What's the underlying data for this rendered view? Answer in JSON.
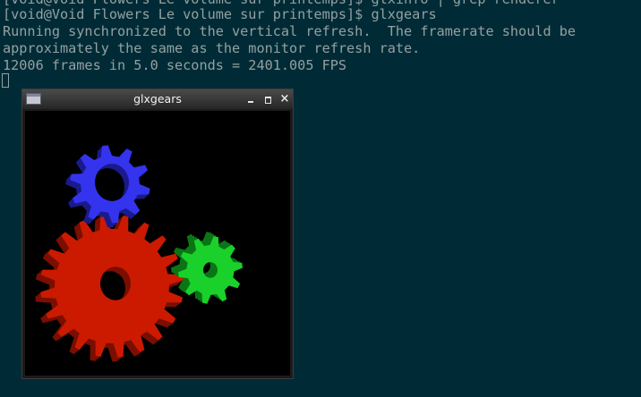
{
  "terminal": {
    "cutoff_line": "[void@Void Flowers Le volume sur printemps]$ glxinfo | grep renderer",
    "prompt": "[void@Void Flowers Le volume sur printemps]$ glxgears",
    "output": [
      "Running synchronized to the vertical refresh.  The framerate should be",
      "approximately the same as the monitor refresh rate.",
      "12006 frames in 5.0 seconds = 2401.005 FPS"
    ]
  },
  "window": {
    "title": "glxgears",
    "icon": "app-window-icon",
    "buttons": {
      "minimize": "minimize-icon",
      "maximize": "maximize-icon",
      "close_glyph": "×"
    }
  },
  "gears": [
    {
      "name": "red-gear",
      "color": "#cc1a00",
      "side_color": "#7a0e00"
    },
    {
      "name": "green-gear",
      "color": "#19d12a",
      "side_color": "#0a7514"
    },
    {
      "name": "blue-gear",
      "color": "#3434ee",
      "side_color": "#1a1a8a"
    }
  ],
  "colors": {
    "terminal_bg": "#002b36",
    "terminal_fg": "#93a1a1",
    "canvas_bg": "#000000"
  }
}
